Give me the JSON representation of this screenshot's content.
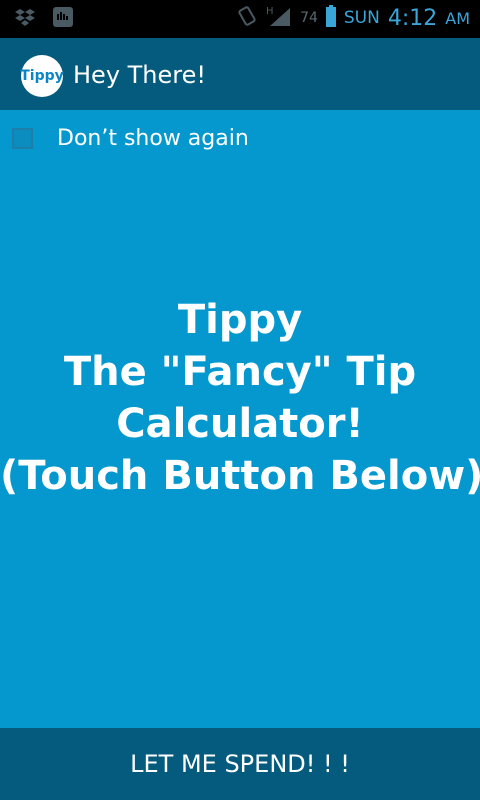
{
  "status_bar": {
    "battery": "74",
    "day": "SUN",
    "time": "4:12",
    "ampm": "AM",
    "icons": [
      "dropbox-icon",
      "voicemail-icon",
      "vibrate-icon",
      "hspa-signal-icon",
      "battery-icon"
    ]
  },
  "action_bar": {
    "icon_text": "Tippy",
    "title": "Hey There!"
  },
  "checkbox": {
    "label": "Don’t show again",
    "checked": false
  },
  "message": {
    "lines": [
      "Tippy",
      "The \"Fancy\" Tip",
      "Calculator!",
      "(Touch Button Below)"
    ]
  },
  "button": {
    "label": "LET ME SPEND! ! !"
  },
  "colors": {
    "background": "#0498cf",
    "bar": "#045b7d",
    "status_bar": "#000000",
    "status_text": "#3aa6d8"
  }
}
